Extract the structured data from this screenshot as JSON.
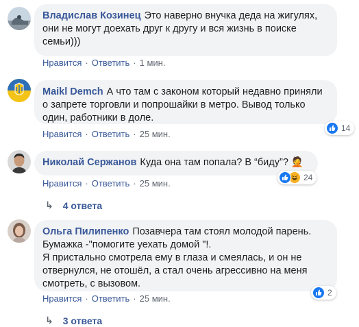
{
  "comments": [
    {
      "author": "Владислав Козинец",
      "lines": [
        "Это наверно внучка деда на жигулях,",
        "они не могут доехать друг к другу и вся жизнь в поиске",
        "семьи)))"
      ],
      "like": "Нравится",
      "reply": "Ответить",
      "time": "1 мин."
    },
    {
      "author": "Maikl Demch",
      "lines": [
        "А что там с законом который недавно приняли",
        "о запрете торговли и попрошайки в метро. Вывод только",
        "один, работники в доле."
      ],
      "like": "Нравится",
      "reply": "Ответить",
      "time": "25 мин.",
      "reaction_count": "14",
      "reaction_icons": [
        "like-icon"
      ]
    },
    {
      "author": "Николай Сержанов",
      "lines": [
        "Куда она там попала? В “биду”? 🤦"
      ],
      "like": "Нравится",
      "reply": "Ответить",
      "time": "25 мин.",
      "reaction_count": "24",
      "reaction_icons": [
        "like-icon",
        "haha-icon"
      ],
      "replies_label": "4 ответа"
    },
    {
      "author": "Ольга Пилипенко",
      "lines": [
        "Позавчера там стоял молодой парень.",
        "Бумажка -\"помогите уехать домой \"!.",
        "Я пристально смотрела ему в глаза и смеялась, и он не",
        "отвернулся, не отошёл, а стал очень агрессивно на меня",
        "смотреть, с вызовом."
      ],
      "like": "Нравится",
      "reply": "Ответить",
      "time": "25 мин.",
      "reaction_count": "2",
      "reaction_icons": [
        "like-icon"
      ],
      "replies_label": "3 ответа"
    }
  ],
  "colors": {
    "link": "#385898",
    "bubble": "#f2f3f5",
    "meta": "#606770",
    "like_blue": "#1877f2",
    "haha_yellow": "#f7b125"
  }
}
